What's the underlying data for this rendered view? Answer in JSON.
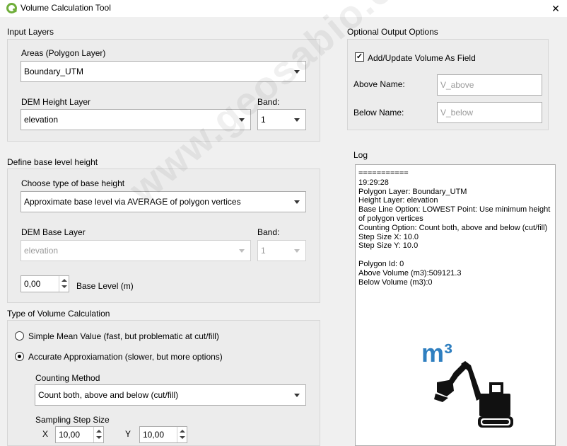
{
  "window": {
    "title": "Volume Calculation Tool",
    "close_glyph": "✕"
  },
  "input_layers": {
    "section_label": "Input Layers",
    "areas_label": "Areas (Polygon Layer)",
    "areas_value": "Boundary_UTM",
    "dem_label": "DEM Height Layer",
    "dem_value": "elevation",
    "band_label": "Band:",
    "band_value": "1"
  },
  "output_options": {
    "section_label": "Optional Output Options",
    "add_field_label": "Add/Update Volume As Field",
    "add_field_checked": true,
    "above_label": "Above Name:",
    "above_placeholder": "V_above",
    "below_label": "Below Name:",
    "below_placeholder": "V_below"
  },
  "base_level": {
    "section_label": "Define base level height",
    "type_label": "Choose type of base height",
    "type_value": "Approximate base level via AVERAGE of polygon vertices",
    "dem_base_label": "DEM Base Layer",
    "dem_base_value": "elevation",
    "band_label": "Band:",
    "band_value": "1",
    "level_value": "0,00",
    "level_label": "Base Level (m)"
  },
  "calc_type": {
    "section_label": "Type of Volume Calculation",
    "simple_label": "Simple Mean Value  (fast, but problematic at cut/fill)",
    "accurate_label": "Accurate Approxiamation (slower, but more options)",
    "selected": "accurate",
    "counting_label": "Counting Method",
    "counting_value": "Count both, above and below (cut/fill)",
    "sampling_label": "Sampling Step Size",
    "x_label": "X",
    "x_value": "10,00",
    "y_label": "Y",
    "y_value": "10,00"
  },
  "log": {
    "label": "Log",
    "lines": [
      "===========",
      "19:29:28",
      "Polygon Layer: Boundary_UTM",
      "Height Layer: elevation",
      "Base Line Option: LOWEST Point: Use minimum height of polygon vertices",
      "Counting Option: Count both, above and below (cut/fill)",
      "Step Size X: 10.0",
      "Step Size Y: 10.0",
      "",
      "Polygon Id: 0",
      "Above Volume (m3):509121.3",
      "Below Volume (m3):0"
    ]
  },
  "logo": {
    "text": "m³",
    "color": "#2f7fc0"
  },
  "colors": {
    "accent_logo": "#2f7fc0",
    "qgis_green": "#6fae3a"
  },
  "watermark": {
    "text": "www.geosabio.com.br"
  }
}
